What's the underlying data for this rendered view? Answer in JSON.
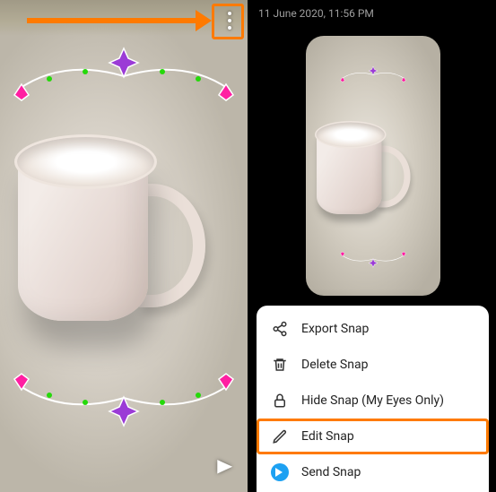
{
  "annotation": {
    "highlight_color": "#ff7a00",
    "arrow_target": "more-menu-button",
    "highlighted_menu_item": "edit_snap"
  },
  "left": {
    "more_icon": "more-vertical-icon",
    "send_icon": "send-caret-icon"
  },
  "right": {
    "timestamp": "11 June 2020, 11:56 PM"
  },
  "menu": {
    "items": [
      {
        "key": "export_snap",
        "label": "Export Snap",
        "icon": "share-icon"
      },
      {
        "key": "delete_snap",
        "label": "Delete Snap",
        "icon": "trash-icon"
      },
      {
        "key": "hide_snap",
        "label": "Hide Snap (My Eyes Only)",
        "icon": "lock-icon"
      },
      {
        "key": "edit_snap",
        "label": "Edit Snap",
        "icon": "pencil-icon"
      },
      {
        "key": "send_snap",
        "label": "Send Snap",
        "icon": "send-filled-icon"
      }
    ]
  }
}
